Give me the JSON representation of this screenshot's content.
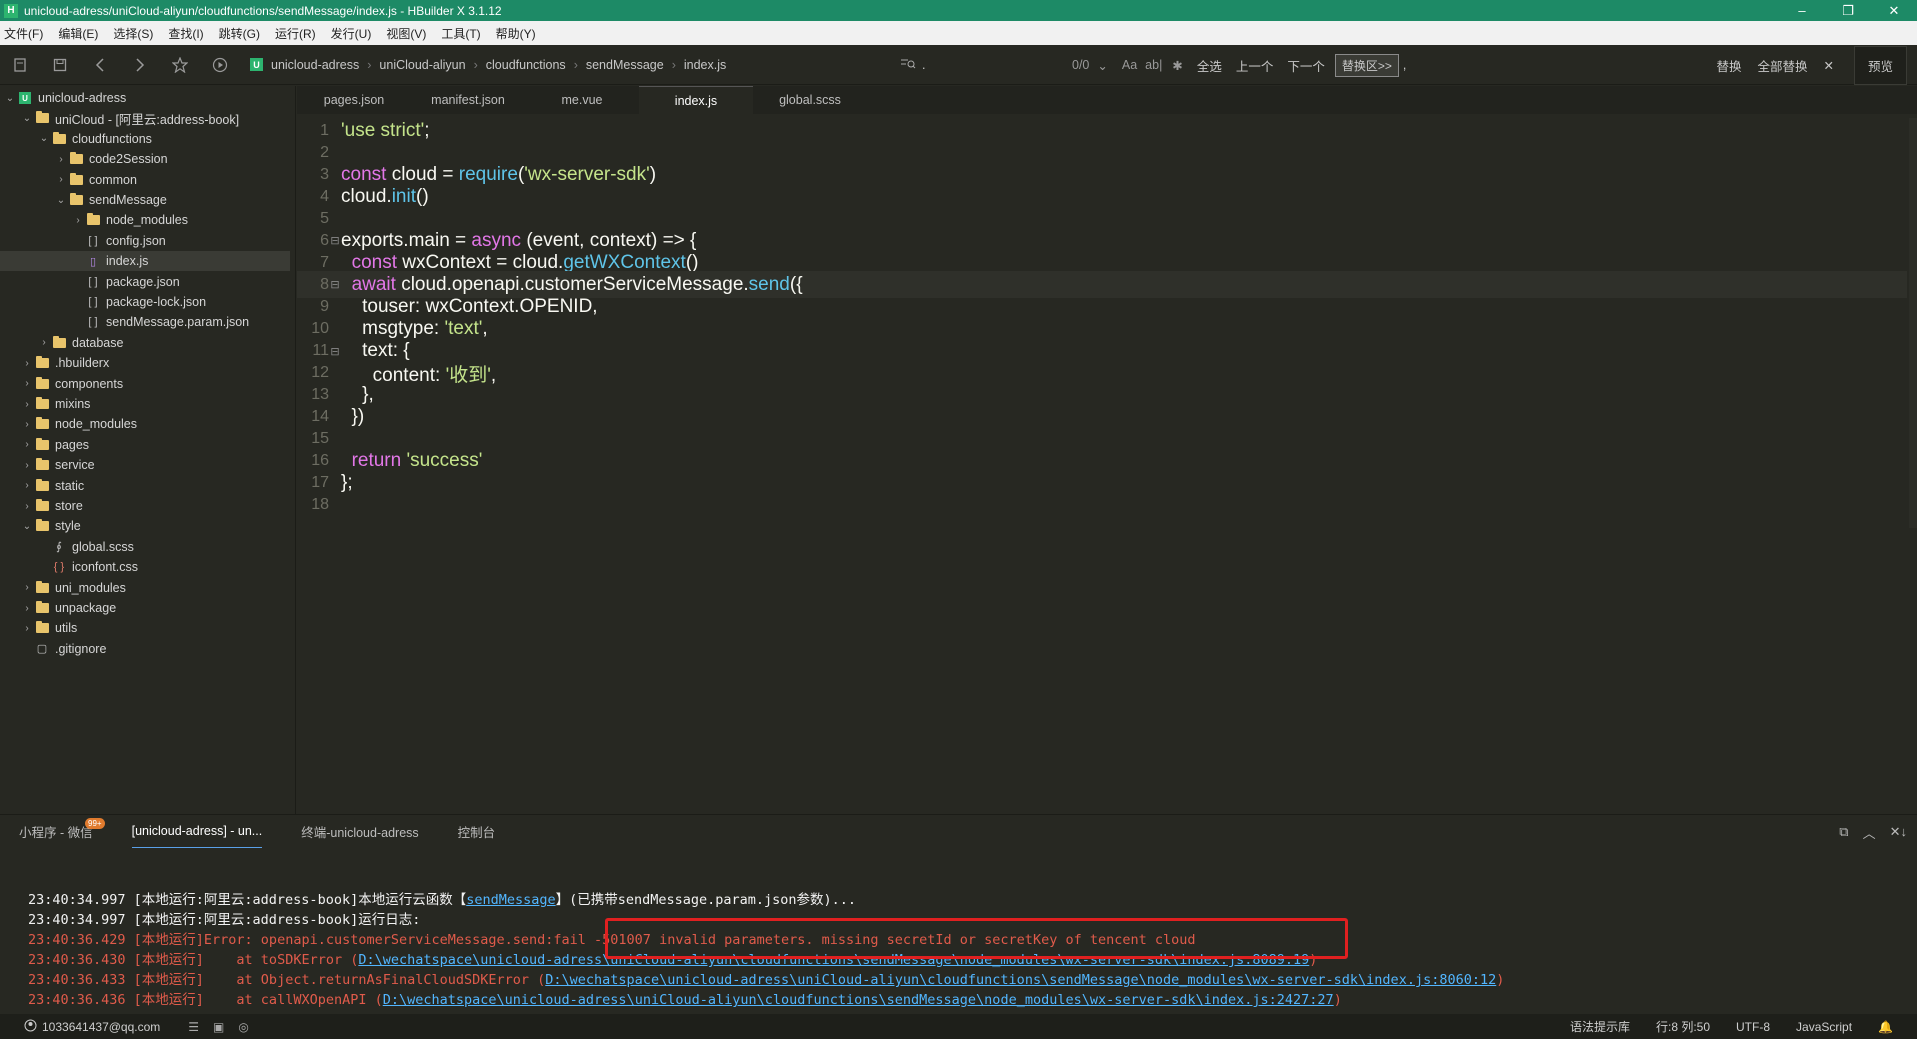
{
  "window": {
    "title": "unicloud-adress/uniCloud-aliyun/cloudfunctions/sendMessage/index.js - HBuilder X 3.1.12",
    "app_icon": "H",
    "controls": [
      "–",
      "❐",
      "✕"
    ]
  },
  "menu": [
    "文件(F)",
    "编辑(E)",
    "选择(S)",
    "查找(I)",
    "跳转(G)",
    "运行(R)",
    "发行(U)",
    "视图(V)",
    "工具(T)",
    "帮助(Y)"
  ],
  "breadcrumb": {
    "project_icon": "U",
    "items": [
      "unicloud-adress",
      "uniCloud-aliyun",
      "cloudfunctions",
      "sendMessage",
      "index.js"
    ]
  },
  "find": {
    "cursor": ".",
    "count": "0/0",
    "options": [
      "Aa",
      "ab|"
    ],
    "select_all": "全选",
    "prev": "上一个",
    "next": "下一个",
    "replace_area": "替换区>>",
    "replace_value": ",",
    "replace": "替换",
    "replace_all": "全部替换",
    "close": "✕",
    "preview": "预览"
  },
  "tree": [
    {
      "label": "unicloud-adress",
      "depth": 0,
      "type": "project",
      "expanded": true
    },
    {
      "label": "uniCloud - [阿里云:address-book]",
      "depth": 1,
      "type": "folder",
      "expanded": true
    },
    {
      "label": "cloudfunctions",
      "depth": 2,
      "type": "folder",
      "expanded": true
    },
    {
      "label": "code2Session",
      "depth": 3,
      "type": "folder",
      "expanded": false
    },
    {
      "label": "common",
      "depth": 3,
      "type": "folder",
      "expanded": false
    },
    {
      "label": "sendMessage",
      "depth": 3,
      "type": "folder",
      "expanded": true
    },
    {
      "label": "node_modules",
      "depth": 4,
      "type": "folder",
      "expanded": false
    },
    {
      "label": "config.json",
      "depth": 4,
      "type": "json"
    },
    {
      "label": "index.js",
      "depth": 4,
      "type": "js",
      "selected": true
    },
    {
      "label": "package.json",
      "depth": 4,
      "type": "json"
    },
    {
      "label": "package-lock.json",
      "depth": 4,
      "type": "json"
    },
    {
      "label": "sendMessage.param.json",
      "depth": 4,
      "type": "json"
    },
    {
      "label": "database",
      "depth": 2,
      "type": "folder",
      "expanded": false
    },
    {
      "label": ".hbuilderx",
      "depth": 1,
      "type": "folder",
      "expanded": false
    },
    {
      "label": "components",
      "depth": 1,
      "type": "folder",
      "expanded": false
    },
    {
      "label": "mixins",
      "depth": 1,
      "type": "folder",
      "expanded": false
    },
    {
      "label": "node_modules",
      "depth": 1,
      "type": "folder",
      "expanded": false
    },
    {
      "label": "pages",
      "depth": 1,
      "type": "folder",
      "expanded": false
    },
    {
      "label": "service",
      "depth": 1,
      "type": "folder",
      "expanded": false
    },
    {
      "label": "static",
      "depth": 1,
      "type": "folder",
      "expanded": false
    },
    {
      "label": "store",
      "depth": 1,
      "type": "folder",
      "expanded": false
    },
    {
      "label": "style",
      "depth": 1,
      "type": "folder",
      "expanded": true
    },
    {
      "label": "global.scss",
      "depth": 2,
      "type": "scss"
    },
    {
      "label": "iconfont.css",
      "depth": 2,
      "type": "css"
    },
    {
      "label": "uni_modules",
      "depth": 1,
      "type": "folder",
      "expanded": false
    },
    {
      "label": "unpackage",
      "depth": 1,
      "type": "folder",
      "expanded": false
    },
    {
      "label": "utils",
      "depth": 1,
      "type": "folder",
      "expanded": false
    },
    {
      "label": ".gitignore",
      "depth": 1,
      "type": "file"
    }
  ],
  "tabs": [
    {
      "label": "pages.json",
      "active": false
    },
    {
      "label": "manifest.json",
      "active": false
    },
    {
      "label": "me.vue",
      "active": false
    },
    {
      "label": "index.js",
      "active": true
    },
    {
      "label": "global.scss",
      "active": false
    }
  ],
  "code": [
    {
      "n": "1",
      "fold": "",
      "tokens": [
        [
          "s",
          "'use strict'"
        ],
        [
          "p",
          ";"
        ]
      ]
    },
    {
      "n": "2",
      "fold": "",
      "tokens": []
    },
    {
      "n": "3",
      "fold": "",
      "tokens": [
        [
          "k",
          "const"
        ],
        [
          "p",
          " cloud = "
        ],
        [
          "f",
          "require"
        ],
        [
          "p",
          "("
        ],
        [
          "s",
          "'wx-server-sdk'"
        ],
        [
          "p",
          ")"
        ]
      ]
    },
    {
      "n": "4",
      "fold": "",
      "tokens": [
        [
          "p",
          "cloud."
        ],
        [
          "f",
          "init"
        ],
        [
          "p",
          "()"
        ]
      ]
    },
    {
      "n": "5",
      "fold": "",
      "tokens": []
    },
    {
      "n": "6",
      "fold": "⊟",
      "tokens": [
        [
          "p",
          "exports.main = "
        ],
        [
          "k",
          "async"
        ],
        [
          "p",
          " (event, context) => {"
        ]
      ]
    },
    {
      "n": "7",
      "fold": "",
      "tokens": [
        [
          "p",
          "  "
        ],
        [
          "k",
          "const"
        ],
        [
          "p",
          " wxContext = cloud."
        ],
        [
          "f",
          "getWXContext"
        ],
        [
          "p",
          "()"
        ]
      ]
    },
    {
      "n": "8",
      "fold": "⊟",
      "current": true,
      "tokens": [
        [
          "p",
          "  "
        ],
        [
          "k",
          "await"
        ],
        [
          "p",
          " cloud.openapi.customerServiceMessage."
        ],
        [
          "f",
          "send"
        ],
        [
          "p",
          "({"
        ]
      ]
    },
    {
      "n": "9",
      "fold": "",
      "tokens": [
        [
          "p",
          "    touser: wxContext.OPENID,"
        ]
      ]
    },
    {
      "n": "10",
      "fold": "",
      "tokens": [
        [
          "p",
          "    msgtype: "
        ],
        [
          "s",
          "'text'"
        ],
        [
          "p",
          ","
        ]
      ]
    },
    {
      "n": "11",
      "fold": "⊟",
      "tokens": [
        [
          "p",
          "    text: {"
        ]
      ]
    },
    {
      "n": "12",
      "fold": "",
      "tokens": [
        [
          "p",
          "      content: "
        ],
        [
          "s",
          "'收到'"
        ],
        [
          "p",
          ","
        ]
      ]
    },
    {
      "n": "13",
      "fold": "",
      "tokens": [
        [
          "p",
          "    },"
        ]
      ]
    },
    {
      "n": "14",
      "fold": "",
      "tokens": [
        [
          "p",
          "  })"
        ]
      ]
    },
    {
      "n": "15",
      "fold": "",
      "tokens": []
    },
    {
      "n": "16",
      "fold": "",
      "tokens": [
        [
          "p",
          "  "
        ],
        [
          "k",
          "return"
        ],
        [
          "p",
          " "
        ],
        [
          "s",
          "'success'"
        ]
      ]
    },
    {
      "n": "17",
      "fold": "",
      "tokens": [
        [
          "p",
          "};"
        ]
      ]
    },
    {
      "n": "18",
      "fold": "",
      "tokens": []
    }
  ],
  "panel": {
    "tabs": [
      {
        "label": "小程序 - 微信",
        "badge": "99+",
        "active": false
      },
      {
        "label": "[unicloud-adress] - un...",
        "active": true
      },
      {
        "label": "终端-unicloud-adress",
        "active": false
      },
      {
        "label": "控制台",
        "active": false
      }
    ],
    "controls": [
      "⧉",
      "︿",
      "✕↓"
    ]
  },
  "console": [
    {
      "type": "info",
      "parts": [
        [
          "t",
          "23:40:34.997 [本地运行:阿里云:address-book]本地运行云函数【"
        ],
        [
          "l",
          "sendMessage"
        ],
        [
          "t",
          "】(已携带sendMessage.param.json参数)..."
        ]
      ]
    },
    {
      "type": "info",
      "parts": [
        [
          "t",
          "23:40:34.997 [本地运行:阿里云:address-book]运行日志:"
        ]
      ]
    },
    {
      "type": "err",
      "parts": [
        [
          "t",
          "23:40:36.429 [本地运行]Error: openapi.customerServiceMessage.send:fail -501007 invalid parameters. missing secretId or secretKey of tencent cloud"
        ]
      ]
    },
    {
      "type": "err",
      "parts": [
        [
          "t",
          "23:40:36.430 [本地运行]    at toSDKError ("
        ],
        [
          "l",
          "D:\\wechatspace\\unicloud-adress\\uniCloud-aliyun\\cloudfunctions\\sendMessage\\node_modules\\wx-server-sdk\\index.js:8089:19"
        ],
        [
          "t",
          ")"
        ]
      ]
    },
    {
      "type": "err",
      "parts": [
        [
          "t",
          "23:40:36.433 [本地运行]    at Object.returnAsFinalCloudSDKError ("
        ],
        [
          "l",
          "D:\\wechatspace\\unicloud-adress\\uniCloud-aliyun\\cloudfunctions\\sendMessage\\node_modules\\wx-server-sdk\\index.js:8060:12"
        ],
        [
          "t",
          ")"
        ]
      ]
    },
    {
      "type": "err",
      "parts": [
        [
          "t",
          "23:40:36.436 [本地运行]    at callWXOpenAPI ("
        ],
        [
          "l",
          "D:\\wechatspace\\unicloud-adress\\uniCloud-aliyun\\cloudfunctions\\sendMessage\\node_modules\\wx-server-sdk\\index.js:2427:27"
        ],
        [
          "t",
          ")"
        ]
      ]
    }
  ],
  "status": {
    "user": "1033641437@qq.com",
    "hint": "语法提示库",
    "position": "行:8  列:50",
    "encoding": "UTF-8",
    "language": "JavaScript"
  },
  "colors": {
    "titlebar": "#1d8a66",
    "editor_bg": "#272822",
    "string": "#c4e48b",
    "keyword": "#e277e7",
    "function": "#5fc4e8",
    "error": "#e05b4b",
    "link": "#52b6ff",
    "highlight_box": "#e02020"
  }
}
